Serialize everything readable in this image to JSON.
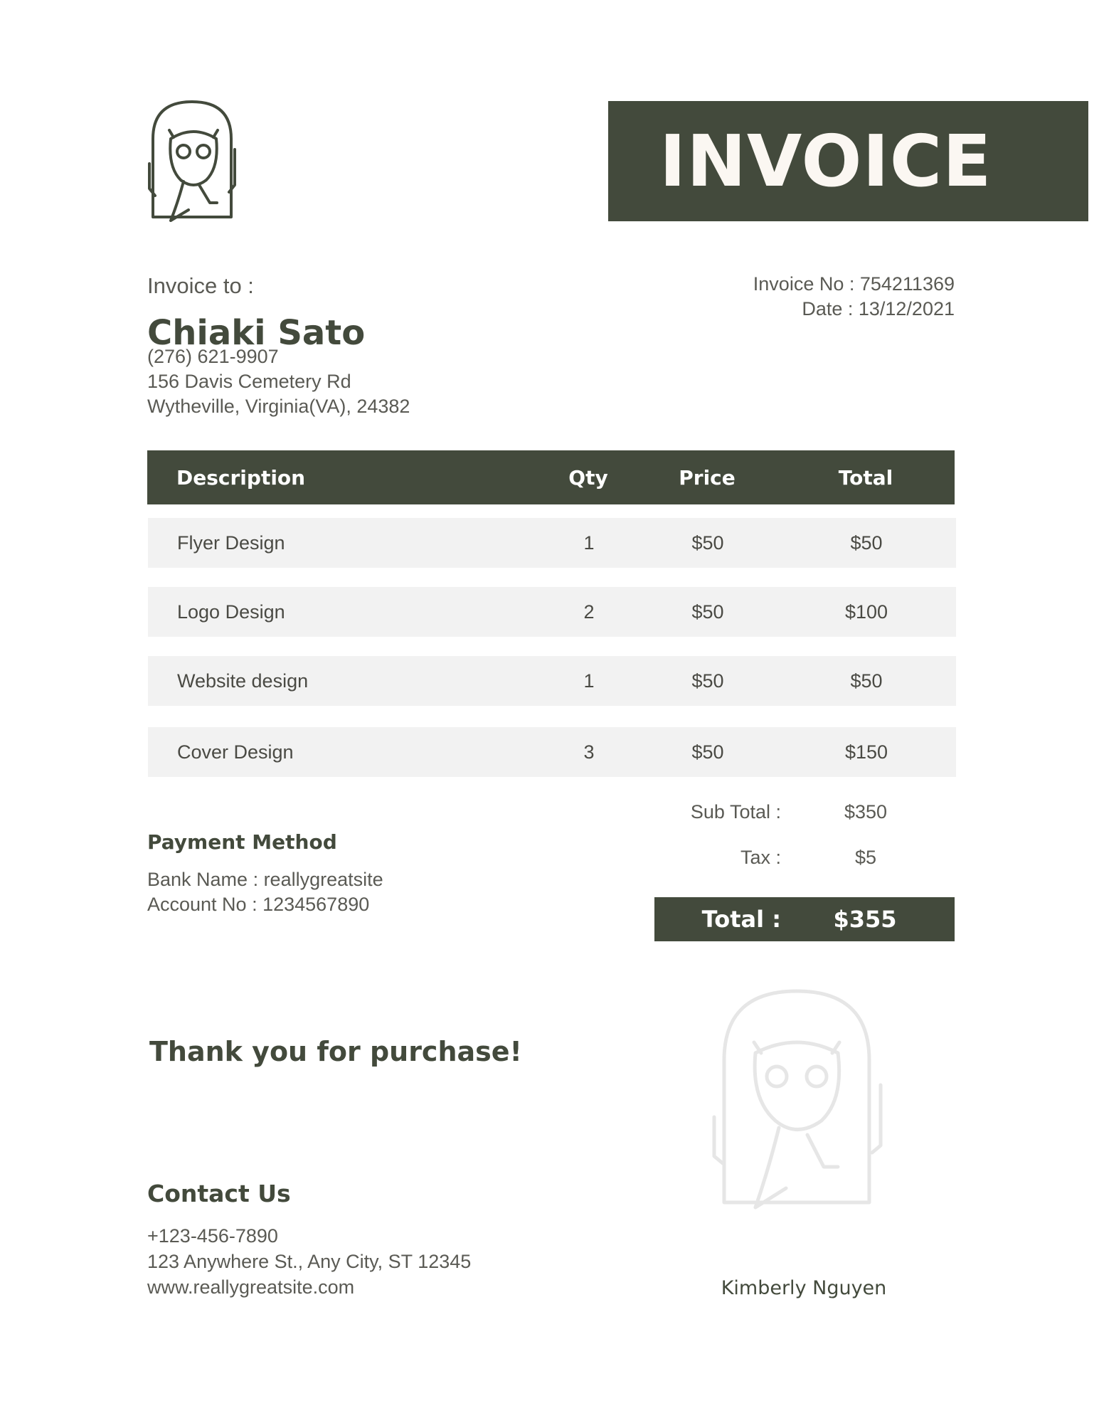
{
  "header": {
    "title": "INVOICE",
    "logo_icon": "owl-icon"
  },
  "invoice_to": {
    "label": "Invoice to :",
    "name": "Chiaki Sato",
    "phone": "(276) 621-9907",
    "address_line1": "156 Davis Cemetery Rd",
    "address_line2": "Wytheville, Virginia(VA), 24382"
  },
  "meta": {
    "invoice_no": "Invoice No : 754211369",
    "date": "Date : 13/12/2021"
  },
  "table": {
    "headers": {
      "description": "Description",
      "qty": "Qty",
      "price": "Price",
      "total": "Total"
    },
    "rows": [
      {
        "description": "Flyer Design",
        "qty": "1",
        "price": "$50",
        "total": "$50"
      },
      {
        "description": "Logo Design",
        "qty": "2",
        "price": "$50",
        "total": "$100"
      },
      {
        "description": "Website design",
        "qty": "1",
        "price": "$50",
        "total": "$50"
      },
      {
        "description": "Cover Design",
        "qty": "3",
        "price": "$50",
        "total": "$150"
      }
    ]
  },
  "summary": {
    "subtotal_label": "Sub Total :",
    "subtotal_value": "$350",
    "tax_label": "Tax :",
    "tax_value": "$5",
    "total_label": "Total :",
    "total_value": "$355"
  },
  "payment": {
    "title": "Payment Method",
    "bank": "Bank Name : reallygreatsite",
    "account": "Account No : 1234567890"
  },
  "thanks": "Thank you for purchase!",
  "contact": {
    "title": "Contact Us",
    "phone": "+123-456-7890",
    "address": "123 Anywhere St., Any City, ST 12345",
    "website": "www.reallygreatsite.com"
  },
  "signature": {
    "name": "Kimberly Nguyen",
    "emblem_icon": "owl-watermark-icon"
  },
  "colors": {
    "accent": "#434a3c",
    "row_bg": "#f2f2f2",
    "watermark": "#e6e6e6"
  }
}
